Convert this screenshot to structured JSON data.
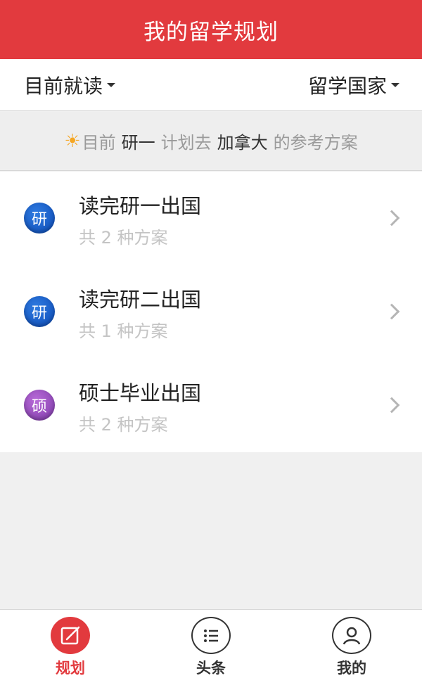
{
  "header": {
    "title": "我的留学规划"
  },
  "filters": {
    "current_study": "目前就读",
    "country": "留学国家"
  },
  "summary": {
    "prefix": "目前",
    "grade": "研一",
    "middle": "计划去",
    "country": "加拿大",
    "suffix": "的参考方案"
  },
  "plans": [
    {
      "badge": "研",
      "title": "读完研一出国",
      "subtitle": "共 2 种方案",
      "badge_color": "#1a5fcf"
    },
    {
      "badge": "研",
      "title": "读完研二出国",
      "subtitle": "共 1 种方案",
      "badge_color": "#1a5fcf"
    },
    {
      "badge": "硕",
      "title": "硕士毕业出国",
      "subtitle": "共 2 种方案",
      "badge_color": "#9b4fc4"
    }
  ],
  "tabs": [
    {
      "label": "规划",
      "icon": "edit-icon",
      "active": true
    },
    {
      "label": "头条",
      "icon": "list-icon",
      "active": false
    },
    {
      "label": "我的",
      "icon": "user-icon",
      "active": false
    }
  ],
  "colors": {
    "accent": "#e23a3e",
    "muted": "#c4c4c4",
    "sun": "#f5a623"
  }
}
